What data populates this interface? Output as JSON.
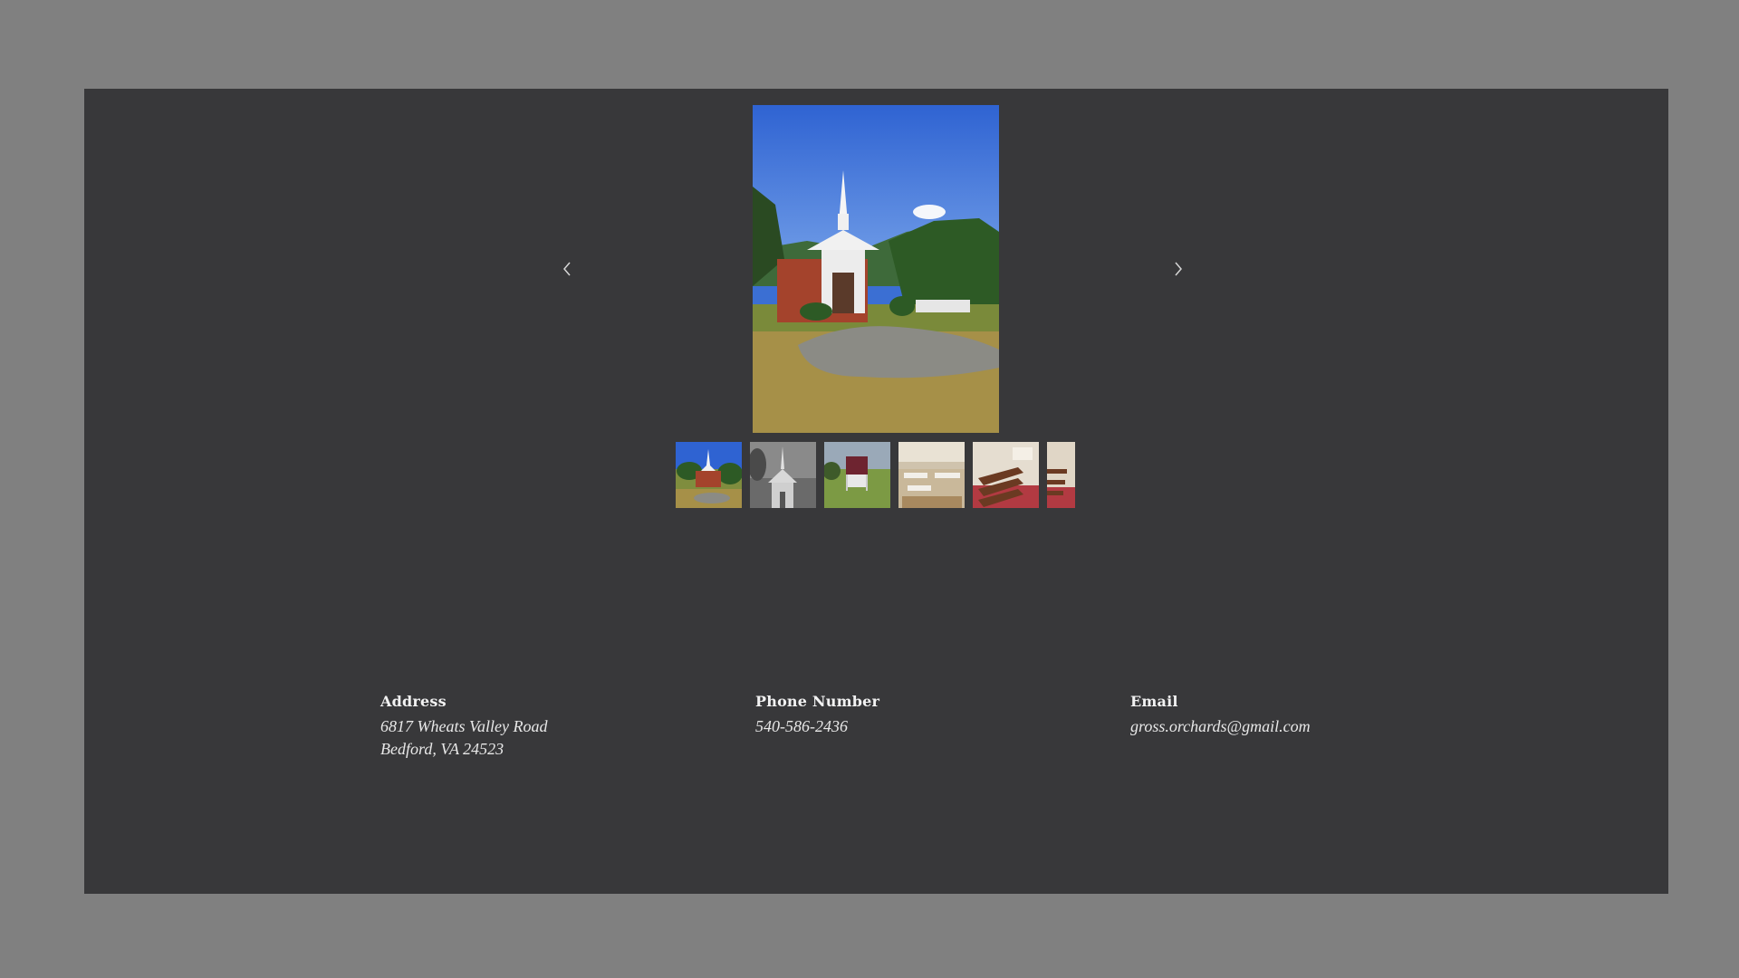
{
  "gallery": {
    "prev_icon": "chevron-left-icon",
    "next_icon": "chevron-right-icon",
    "main_photo": "church-exterior-photo",
    "thumbnails": [
      {
        "subject": "church-exterior",
        "active": true
      },
      {
        "subject": "church-steeple-bw",
        "active": false
      },
      {
        "subject": "church-sign",
        "active": false
      },
      {
        "subject": "fellowship-hall",
        "active": false
      },
      {
        "subject": "sanctuary-pews",
        "active": false
      },
      {
        "subject": "sanctuary-aisle",
        "active": false
      }
    ]
  },
  "contact": {
    "address": {
      "label": "Address",
      "line1": "6817 Wheats Valley Road",
      "line2": "Bedford, VA 24523"
    },
    "phone": {
      "label": "Phone Number",
      "value": "540-586-2436"
    },
    "email": {
      "label": "Email",
      "value": "gross.orchards@gmail.com"
    }
  },
  "colors": {
    "page_background": "#808080",
    "panel_background": "#38383a",
    "text": "#f2f2f2"
  }
}
